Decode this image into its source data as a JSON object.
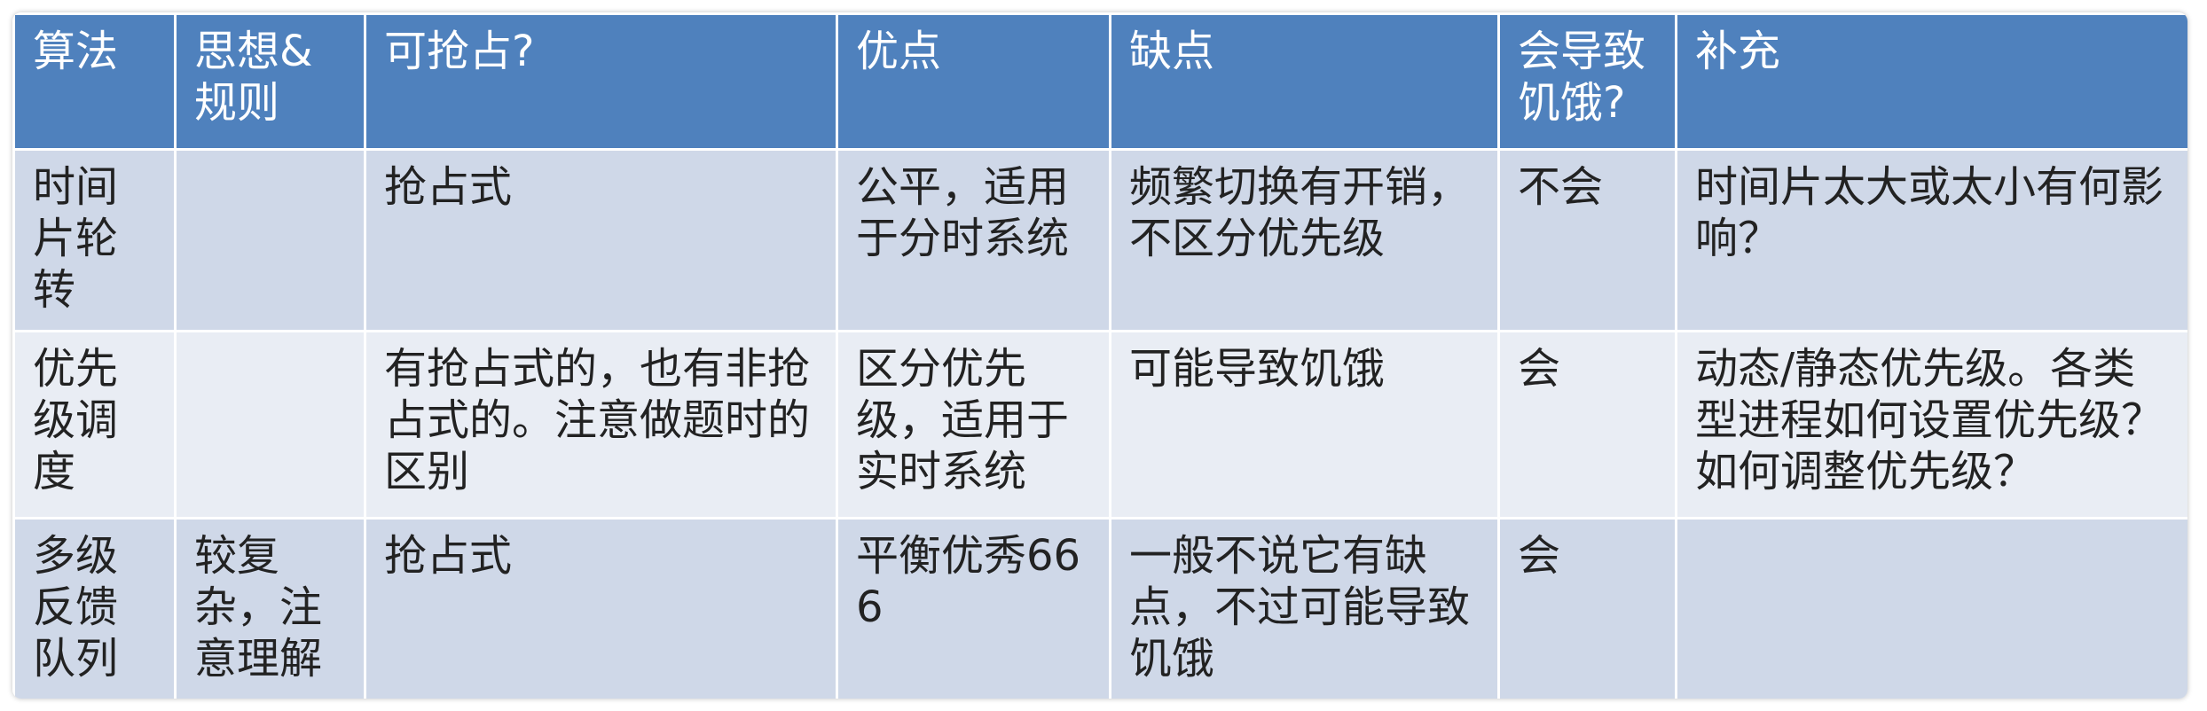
{
  "table": {
    "headers": [
      "算法",
      "思想&规则",
      "可抢占?",
      "优点",
      "缺点",
      "会导致饥饿?",
      "补充"
    ],
    "rows": [
      [
        "时间片轮转",
        "",
        "抢占式",
        "公平，适用于分时系统",
        "频繁切换有开销，不区分优先级",
        "不会",
        "时间片太大或太小有何影响？"
      ],
      [
        "优先级调度",
        "",
        "有抢占式的，也有非抢占式的。注意做题时的区别",
        "区分优先级，适用于实时系统",
        "可能导致饥饿",
        "会",
        "动态/静态优先级。各类型进程如何设置优先级？如何调整优先级？"
      ],
      [
        "多级反馈队列",
        "较复杂，注意理解",
        "抢占式",
        "平衡优秀666",
        "一般不说它有缺点，不过可能导致饥饿",
        "会",
        ""
      ]
    ]
  },
  "colors": {
    "header_bg": "#4f81bd",
    "row_dark": "#cfd8e8",
    "row_light": "#e9edf4"
  }
}
